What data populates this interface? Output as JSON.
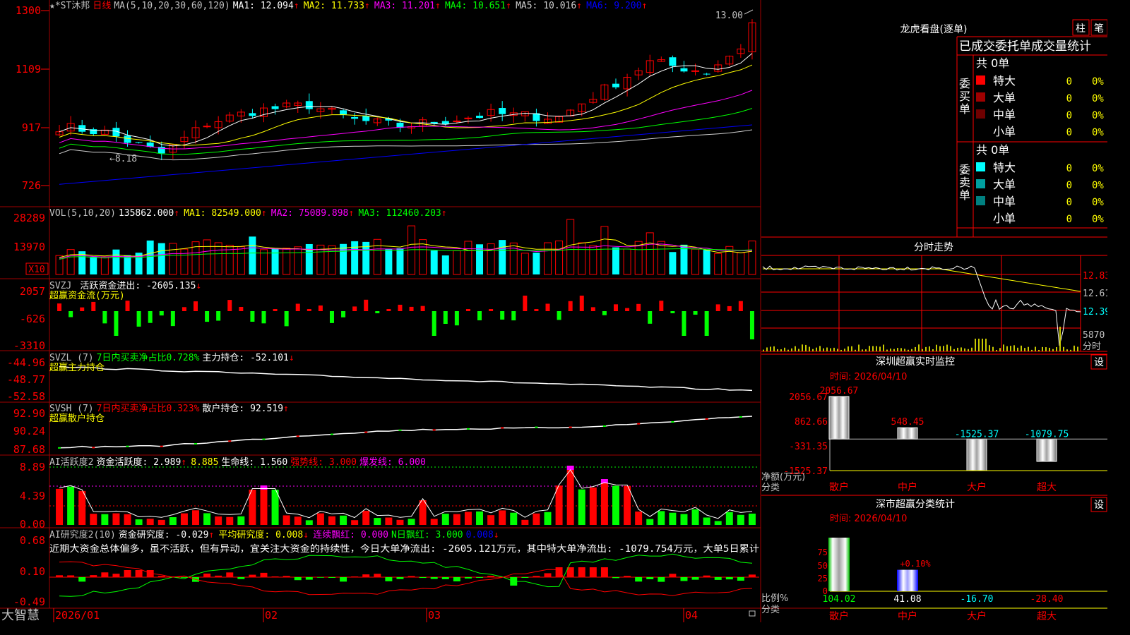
{
  "app": {
    "brand": "大智慧"
  },
  "price_panel": {
    "title": "★*ST沐邦",
    "period": "日线",
    "ma_header": "MA(5,10,20,30,60,120)",
    "ma_values": [
      {
        "label": "MA1: 12.094",
        "arrow": "↑",
        "color": "#ffffff"
      },
      {
        "label": "MA2: 11.733",
        "arrow": "↑",
        "color": "#ffff00"
      },
      {
        "label": "MA3: 11.201",
        "arrow": "↑",
        "color": "#ff00ff"
      },
      {
        "label": "MA4: 10.651",
        "arrow": "↑",
        "color": "#00ff00"
      },
      {
        "label": "MA5: 10.016",
        "arrow": "↑",
        "color": "#d0d0d0"
      },
      {
        "label": "MA6: 9.200",
        "arrow": "↑",
        "color": "#0000ff"
      }
    ],
    "y_ticks": [
      "1300",
      "1109",
      "917",
      "726"
    ],
    "high_label": "13.00",
    "low_label": "←8.18"
  },
  "volume_panel": {
    "header": "VOL(5,10,20)",
    "value": "135862.000",
    "ma_values": [
      {
        "label": "MA1: 82549.000",
        "arrow": "↑",
        "color": "#ffff00"
      },
      {
        "label": "MA2: 75089.898",
        "arrow": "↑",
        "color": "#ff00ff"
      },
      {
        "label": "MA3: 112460.203",
        "arrow": "↑",
        "color": "#00ff00"
      }
    ],
    "y_ticks": [
      "28289",
      "13970"
    ],
    "unit_badge": "X10"
  },
  "svzj_panel": {
    "header": "SVZJ",
    "indicator": "活跃资金进出: -2605.135",
    "arrow": "↓",
    "subtitle": "超赢资金流(万元)",
    "y_ticks": [
      "2057",
      "-626",
      "-3310"
    ]
  },
  "svzl_panel": {
    "header": "SVZL (7)",
    "ratio": "7日内买卖净占比0.728%",
    "holding": "主力持仓: -52.101",
    "arrow": "↓",
    "subtitle": "超赢主力持仓",
    "y_ticks": [
      "-44.96",
      "-48.77",
      "-52.58"
    ]
  },
  "svsh_panel": {
    "header": "SVSH (7)",
    "ratio": "7日内买卖净占比0.323%",
    "holding": "散户持仓: 92.519",
    "arrow": "↑",
    "subtitle": "超赢散户持仓",
    "y_ticks": [
      "92.90",
      "90.24",
      "87.68"
    ]
  },
  "ai_active_panel": {
    "header": "AI活跃度2",
    "items": [
      {
        "label": "资金活跃度: 2.989",
        "arrow": "↑",
        "color": "#ffffff"
      },
      {
        "label": "8.885",
        "arrow": "",
        "color": "#ffff00"
      },
      {
        "label": "生命线: 1.560",
        "arrow": "",
        "color": "#ffffff"
      },
      {
        "label": "强势线: 3.000",
        "arrow": "",
        "color": "#ff0000"
      },
      {
        "label": "爆发线: 6.000",
        "arrow": "",
        "color": "#ff00ff"
      }
    ],
    "y_ticks": [
      "8.89",
      "4.39",
      "0.00"
    ]
  },
  "ai_research_panel": {
    "header": "AI研究度2(10)",
    "items": [
      {
        "label": "资金研究度: -0.029",
        "arrow": "↑",
        "color": "#ffffff"
      },
      {
        "label": "平均研究度: 0.008",
        "arrow": "↓",
        "color": "#ffff00"
      },
      {
        "label": "连续飘红: 0.000",
        "arrow": "",
        "color": "#ff00ff"
      },
      {
        "label": "N日飘红: 3.000",
        "arrow": "",
        "color": "#00ff00"
      },
      {
        "label": "0.008",
        "arrow": "↓",
        "color": "#0000ff"
      }
    ],
    "comment": "近期大资金总体偏多，虽不活跃，但有异动，宜关注大资金的持续性，今日大单净流出: -2605.121万元，其中特大单净流出: -1079.754万元，大单5日累计",
    "y_ticks": [
      "0.68",
      "0.10",
      "-0.49"
    ]
  },
  "x_axis": {
    "labels": [
      "2026/01",
      "02",
      "03",
      "04"
    ]
  },
  "right_panel": {
    "dragon_title": "龙虎看盘(逐单)",
    "btn_zhu": "柱",
    "btn_bi": "笔",
    "stats_header": "已成交委托单成交量统计",
    "buy_label": "委买单",
    "sell_label": "委卖单",
    "buy_total": "共 0单",
    "sell_total": "共 0单",
    "buy_rows": [
      {
        "name": "特大",
        "value": "0",
        "pct": "0%",
        "color": "#ff0000"
      },
      {
        "name": "大单",
        "value": "0",
        "pct": "0%",
        "color": "#a00000"
      },
      {
        "name": "中单",
        "value": "0",
        "pct": "0%",
        "color": "#700000"
      },
      {
        "name": "小单",
        "value": "0",
        "pct": "0%",
        "color": ""
      }
    ],
    "sell_rows": [
      {
        "name": "特大",
        "value": "0",
        "pct": "0%",
        "color": "#00ffff"
      },
      {
        "name": "大单",
        "value": "0",
        "pct": "0%",
        "color": "#00a0a0"
      },
      {
        "name": "中单",
        "value": "0",
        "pct": "0%",
        "color": "#008080"
      },
      {
        "name": "小单",
        "value": "0",
        "pct": "0%",
        "color": ""
      }
    ],
    "intraday_title": "分时走势",
    "intraday_y_ticks": [
      "12.83",
      "12.61",
      "12.39"
    ],
    "intraday_vol_tick": "5870",
    "intraday_vol_unit": "分时",
    "monitor_title": "深圳超赢实时监控",
    "monitor_btn": "设",
    "monitor_time": "时间: 2026/04/10",
    "monitor_y_ticks": [
      "2056.67",
      "862.66",
      "-331.35",
      "-1525.37"
    ],
    "monitor_ylabel": "净额(万元)",
    "monitor_xlabel": "分类",
    "classify_title": "深市超赢分类统计",
    "classify_btn": "设",
    "classify_time": "时间: 2026/04/10",
    "classify_y_ticks": [
      "75",
      "50",
      "25",
      "0"
    ],
    "classify_ylabel": "比例%",
    "classify_xlabel": "分类"
  },
  "chart_data": [
    {
      "type": "bar",
      "title": "深圳超赢实时监控",
      "ylabel": "净额(万元)",
      "xlabel": "分类",
      "categories": [
        "散户",
        "中户",
        "大户",
        "超大"
      ],
      "values": [
        2056.67,
        548.45,
        -1525.37,
        -1079.75
      ],
      "value_labels": [
        "2056.67",
        "548.45",
        "-1525.37",
        "-1079.75"
      ],
      "ylim": [
        -1525.37,
        2056.67
      ]
    },
    {
      "type": "bar",
      "title": "深市超赢分类统计",
      "ylabel": "比例%",
      "xlabel": "分类",
      "categories": [
        "散户",
        "中户",
        "大户",
        "超大"
      ],
      "values": [
        104.02,
        41.08,
        -16.7,
        -28.4
      ],
      "value_labels": [
        "104.02",
        "41.08",
        "-16.70",
        "-28.40"
      ],
      "bar_annotation": "+0.10%",
      "ylim": [
        0,
        75
      ]
    }
  ]
}
